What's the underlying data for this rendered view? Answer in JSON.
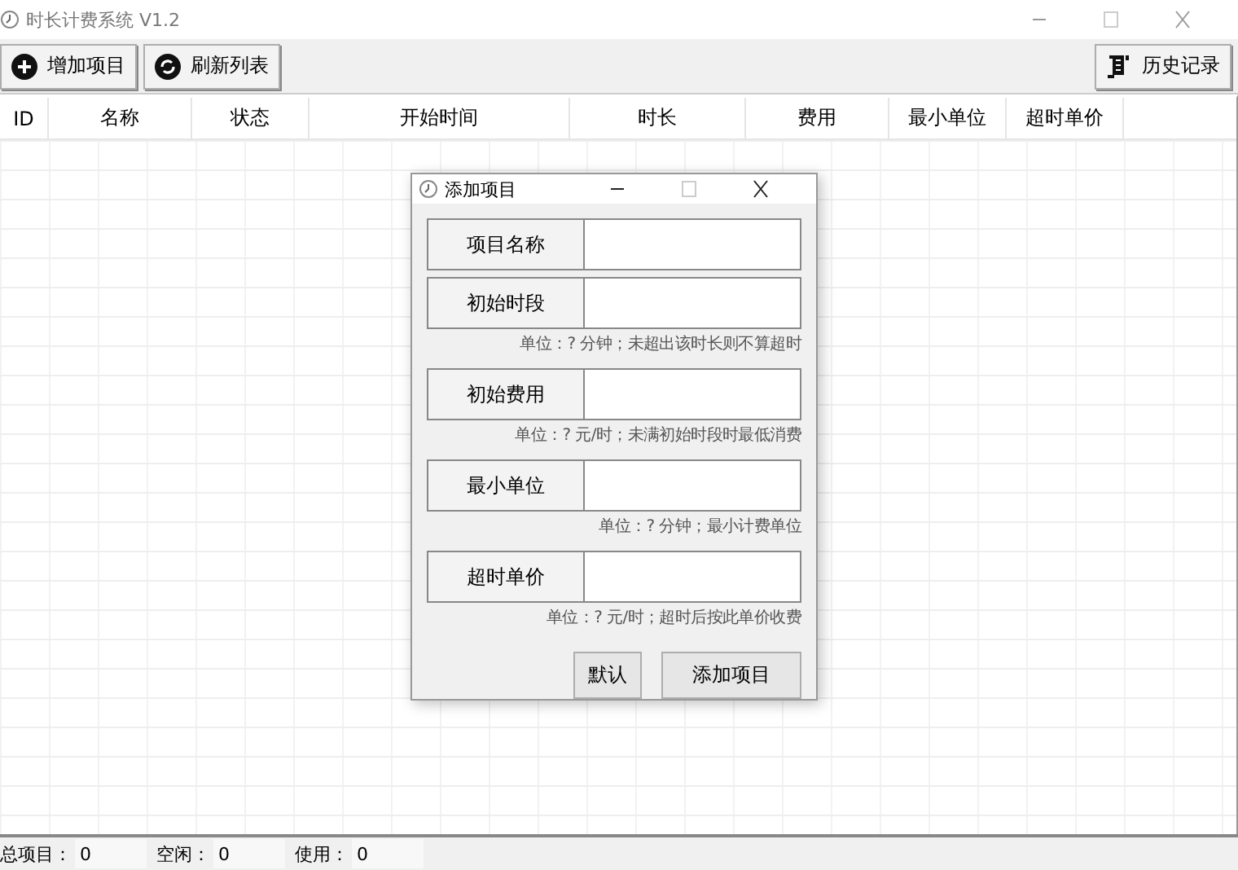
{
  "window": {
    "title": "时长计费系统 V1.2"
  },
  "toolbar": {
    "buttons": [
      {
        "label": "增加项目",
        "kind": "add"
      },
      {
        "label": "刷新列表",
        "kind": "refresh"
      }
    ],
    "history": {
      "label": "历史记录"
    }
  },
  "table": {
    "columns": [
      "ID",
      "名称",
      "状态",
      "开始时间",
      "时长",
      "费用",
      "最小单位",
      "超时单价"
    ]
  },
  "dialog": {
    "title": "添加项目",
    "fields": [
      {
        "label": "项目名称"
      },
      {
        "label": "初始时段",
        "hint": "单位：? 分钟；未超出该时长则不算超时"
      },
      {
        "label": "初始费用",
        "hint": "单位：? 元/时；未满初始时段时最低消费"
      },
      {
        "label": "最小单位",
        "hint": "单位：? 分钟；最小计费单位"
      },
      {
        "label": "超时单价",
        "hint": "单位：? 元/时；超时后按此单价收费"
      }
    ],
    "buttons": [
      "默认",
      "添加项目"
    ]
  },
  "status_bar": [
    {
      "label": "总项目：",
      "value": "0"
    },
    {
      "label": "空闲：",
      "value": "0"
    },
    {
      "label": "使用：",
      "value": "0"
    }
  ]
}
